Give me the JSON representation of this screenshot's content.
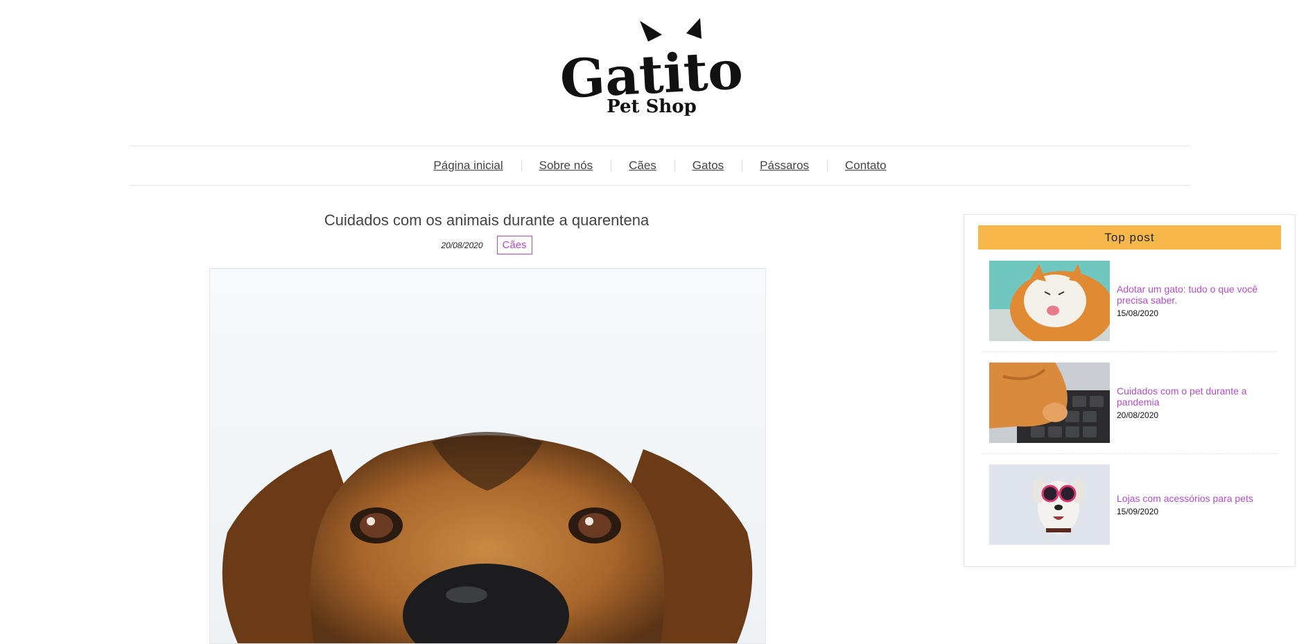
{
  "brand": {
    "name": "Gatito",
    "tagline": "Pet Shop"
  },
  "nav": {
    "items": [
      "Página inicial",
      "Sobre nós",
      "Cães",
      "Gatos",
      "Pássaros",
      "Contato"
    ]
  },
  "post": {
    "title": "Cuidados com os animais durante a quarentena",
    "date": "20/08/2020",
    "category": "Cães"
  },
  "sidebar": {
    "title": "Top post",
    "posts": [
      {
        "title": "Adotar um gato: tudo o que você precisa saber.",
        "date": "15/08/2020"
      },
      {
        "title": "Cuidados com o pet durante a pandemia",
        "date": "20/08/2020"
      },
      {
        "title": "Lojas com acessórios para pets",
        "date": "15/09/2020"
      }
    ]
  },
  "colors": {
    "accent": "#b04fc4",
    "sidebar_header": "#f7b84b"
  }
}
